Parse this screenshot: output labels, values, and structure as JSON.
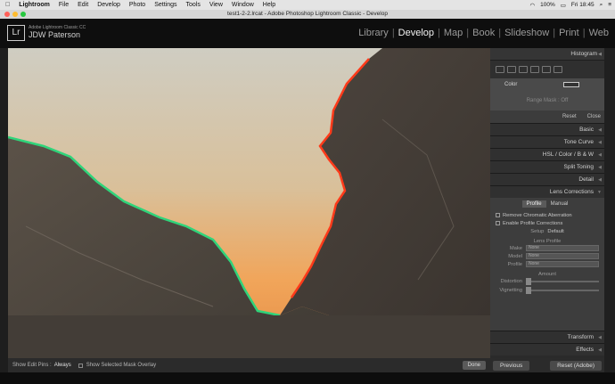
{
  "menubar": {
    "items": [
      "Lightroom",
      "File",
      "Edit",
      "Develop",
      "Photo",
      "Settings",
      "Tools",
      "View",
      "Window",
      "Help"
    ],
    "battery": "100%",
    "clock": "Fri 18:45"
  },
  "window": {
    "title": "test1-2-2.lrcat - Adobe Photoshop Lightroom Classic - Develop"
  },
  "identity": {
    "logo": "Lr",
    "product": "Adobe Lightroom Classic CC",
    "user": "JDW Paterson"
  },
  "modules": [
    "Library",
    "Develop",
    "Map",
    "Book",
    "Slideshow",
    "Print",
    "Web"
  ],
  "active_module": "Develop",
  "toolbar": {
    "show_edit_pins_label": "Show Edit Pins :",
    "show_edit_pins_value": "Always",
    "mask_overlay_label": "Show Selected Mask Overlay",
    "done": "Done"
  },
  "right_panel": {
    "histogram": "Histogram",
    "color_label": "Color",
    "range_mask": "Range Mask : Off",
    "reset": "Reset",
    "close": "Close",
    "sections": [
      "Basic",
      "Tone Curve",
      "HSL  /  Color  /  B & W",
      "Split Toning",
      "Detail",
      "Lens Corrections"
    ],
    "lens": {
      "tab_profile": "Profile",
      "tab_manual": "Manual",
      "remove_ca": "Remove Chromatic Aberration",
      "enable_profile": "Enable Profile Corrections",
      "setup_label": "Setup",
      "setup_value": "Default",
      "lens_profile": "Lens Profile",
      "make_label": "Make",
      "make_value": "None",
      "model_label": "Model",
      "model_value": "None",
      "profile_label": "Profile",
      "profile_value": "None",
      "amount": "Amount",
      "distortion": "Distortion",
      "vignetting": "Vignetting"
    },
    "bottom_sections": [
      "Transform",
      "Effects"
    ],
    "previous": "Previous",
    "reset_adobe": "Reset (Adobe)"
  },
  "colors": {
    "sky_top": "#c8c5b8",
    "sky_glow": "#f0a85a",
    "rock": "#4a4540",
    "fringe_green": "#2fd47a",
    "fringe_red": "#ff3a1a"
  }
}
